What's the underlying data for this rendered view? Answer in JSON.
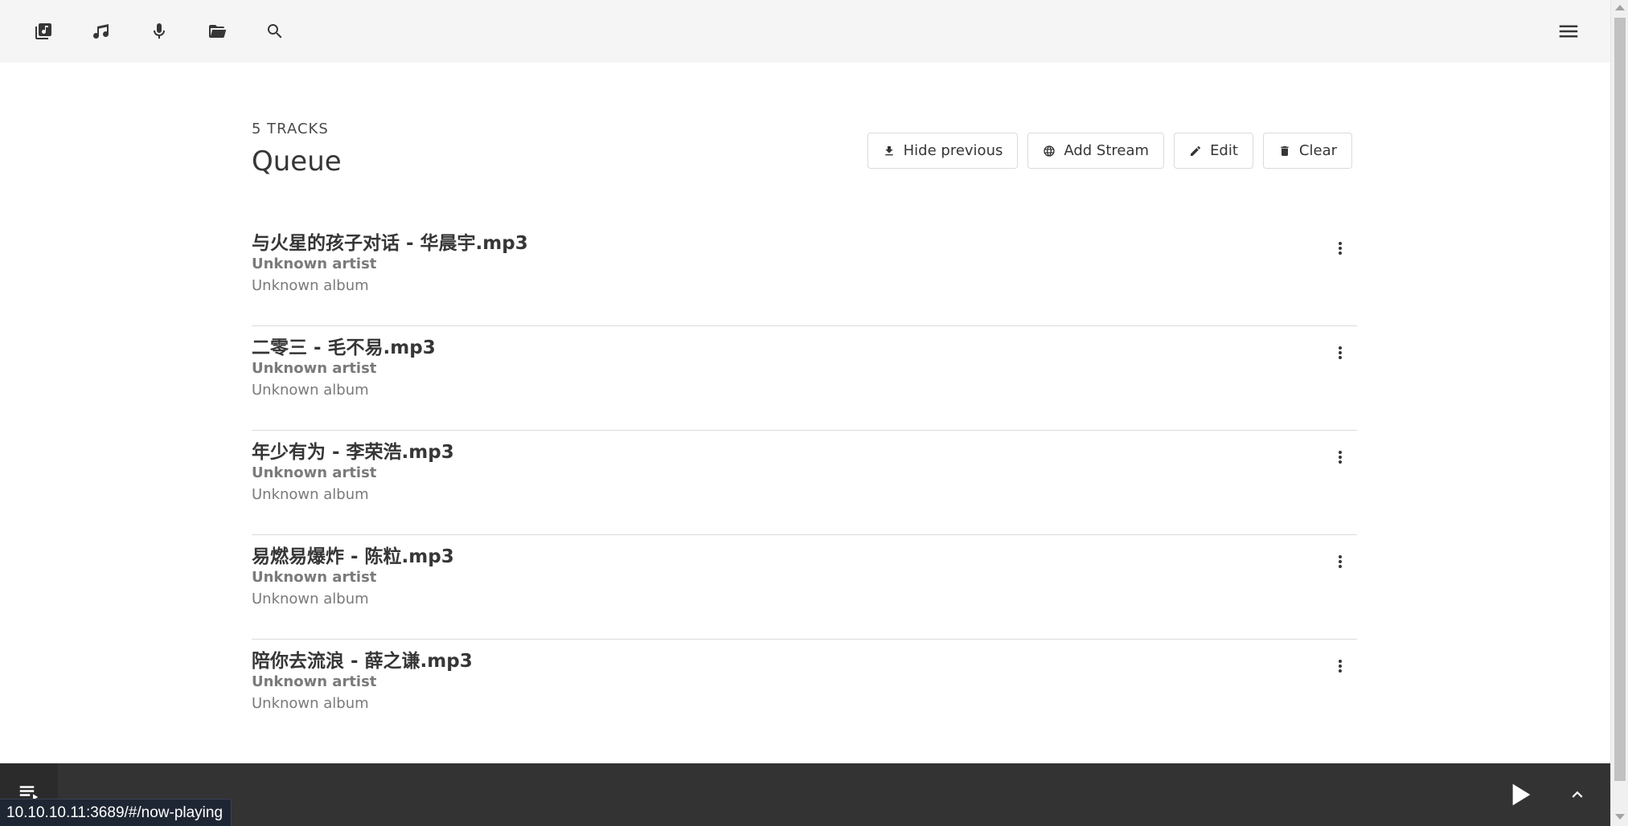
{
  "navbar": {
    "items": [
      {
        "name": "library-icon",
        "label": "Library"
      },
      {
        "name": "music-note-icon",
        "label": "Music"
      },
      {
        "name": "microphone-icon",
        "label": "Podcasts"
      },
      {
        "name": "folder-icon",
        "label": "Files"
      },
      {
        "name": "search-icon",
        "label": "Search"
      }
    ],
    "burger_icon": "menu-icon"
  },
  "queue": {
    "count_label": "5 TRACKS",
    "title": "Queue",
    "actions": {
      "hide_previous": "Hide previous",
      "add_stream": "Add Stream",
      "edit": "Edit",
      "clear": "Clear"
    },
    "tracks": [
      {
        "title": "与火星的孩子对话 - 华晨宇.mp3",
        "artist": "Unknown artist",
        "album": "Unknown album"
      },
      {
        "title": "二零三 - 毛不易.mp3",
        "artist": "Unknown artist",
        "album": "Unknown album"
      },
      {
        "title": "年少有为 - 李荣浩.mp3",
        "artist": "Unknown artist",
        "album": "Unknown album"
      },
      {
        "title": "易燃易爆炸 - 陈粒.mp3",
        "artist": "Unknown artist",
        "album": "Unknown album"
      },
      {
        "title": "陪你去流浪 - 薛之谦.mp3",
        "artist": "Unknown artist",
        "album": "Unknown album"
      }
    ]
  },
  "player": {
    "queue_icon": "queue-icon",
    "play_icon": "play-icon",
    "expand_icon": "chevron-up-icon"
  },
  "status_bar": {
    "url": "10.10.10.11:3689/#/now-playing"
  },
  "colors": {
    "navbar_bg": "#f5f5f5",
    "player_bg": "#333333",
    "text_primary": "#363636",
    "text_secondary": "#7a7a7a"
  }
}
